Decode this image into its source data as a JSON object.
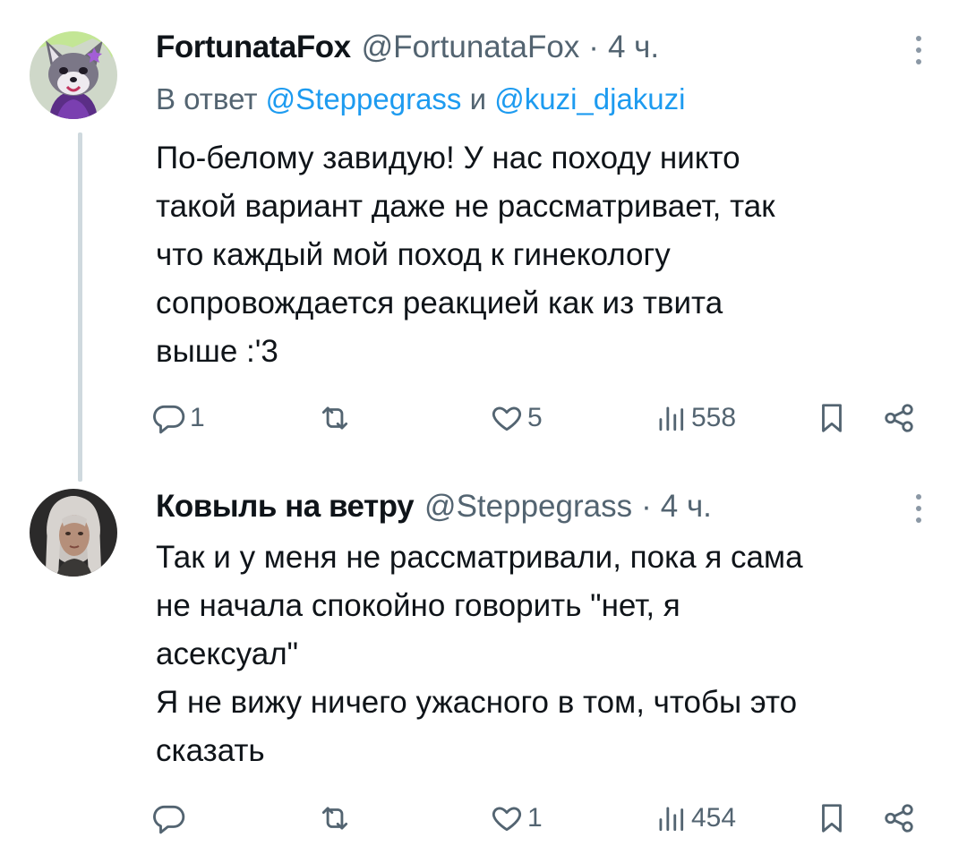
{
  "tweets": [
    {
      "display_name": "FortunataFox",
      "handle": "@FortunataFox",
      "separator": "·",
      "time": "4 ч.",
      "reply_prefix": "В ответ",
      "reply_mention_1": "@Steppegrass",
      "reply_conjunction": "и",
      "reply_mention_2": "@kuzi_djakuzi",
      "lines": [
        "По-белому завидую! У нас походу никто",
        "такой вариант даже не рассматривает, так",
        "что каждый мой поход к гинекологу",
        "сопровождается реакцией как из твита",
        "выше :'3"
      ],
      "replies": "1",
      "retweets": "",
      "likes": "5",
      "views": "558",
      "avatar_icon": "fox-character-avatar"
    },
    {
      "display_name": "Ковыль на ветру",
      "handle": "@Steppegrass",
      "separator": "·",
      "time": "4 ч.",
      "lines": [
        "Так и у меня не рассматривали, пока я сама",
        "не начала спокойно говорить \"нет, я",
        "асексуал\"",
        "Я не вижу ничего ужасного в том, чтобы это",
        "сказать"
      ],
      "replies": "",
      "retweets": "",
      "likes": "1",
      "views": "454",
      "avatar_icon": "woman-portrait-avatar"
    }
  ],
  "colors": {
    "text": "#0f1419",
    "secondary": "#536471",
    "link": "#1d9bf0",
    "thread_line": "#cfd9de"
  },
  "icons": [
    "reply-icon",
    "retweet-icon",
    "like-icon",
    "views-icon",
    "bookmark-icon",
    "share-icon",
    "more-icon"
  ]
}
